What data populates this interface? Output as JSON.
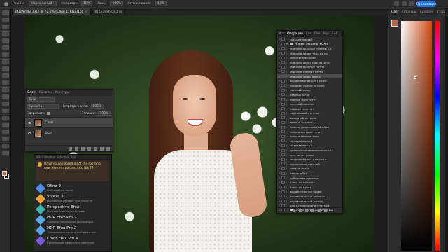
{
  "menubar": {
    "mode_label": "Режим:",
    "mode_value": "Нормальный",
    "opacity_label": "Непрозр.:",
    "opacity_value": "10%",
    "flow_label": "Наж.:",
    "flow_value": "100%",
    "smoothing_label": "Сглаживание:",
    "smoothing_value": "10%",
    "share_label": "Публикация"
  },
  "doc_tabs": [
    {
      "label": "0U2A7864.CR2 @ 72,6% (Слой 1, RGB/16)",
      "close": "×"
    },
    {
      "label": "0U2A7886.CR2 @",
      "close": ""
    }
  ],
  "layers_panel": {
    "tabs": [
      "Слои",
      "Каналы",
      "Контуры"
    ],
    "kind_value": "Вид",
    "blend_value": "Яркость",
    "opacity_label": "Непрозрачность:",
    "opacity_value": "100%",
    "lock_label": "Закрепить:",
    "fill_label": "Заливка:",
    "fill_value": "100%",
    "layers": [
      {
        "name": "Слой 1",
        "selected": true
      },
      {
        "name": "Фон",
        "selected": false
      }
    ]
  },
  "plugins_panel": {
    "header": "Nik Collection Selective Tool",
    "promo_text": "Have you explored all of the exciting new features packed into Nik 7?",
    "items": [
      {
        "name": "Dfine 2",
        "desc": "Уменьшение шума",
        "color": "#4a90e2"
      },
      {
        "name": "Viveza 3",
        "desc": "Настройка цвета и тональности",
        "color": "#e6a23c"
      },
      {
        "name": "Perspective Efex",
        "desc": "Исправление перспективы",
        "color": "#3fb8af"
      },
      {
        "name": "HDR Efex Pro 2",
        "desc": "Слияние нескольких экспозиций",
        "color": "#5aa9e6"
      },
      {
        "name": "HDR Efex Pro 2",
        "desc": "Тонирование одного изображения",
        "color": "#5aa9e6"
      },
      {
        "name": "Color Efex Pro 4",
        "desc": "Креативные эффекты и цветокор",
        "color": "#7a5bd6"
      }
    ]
  },
  "actions_panel": {
    "tabs": [
      "Ист",
      "Операции",
      "Кол",
      "Сво",
      "Кор",
      "Биб"
    ],
    "active_tab": "Операции",
    "rows": [
      {
        "label": "сохранение веб",
        "caret": "",
        "kind": "item"
      },
      {
        "label": "НОВЫЕ ЭКШЕНЫ КОЖА",
        "caret": "▾",
        "kind": "set"
      },
      {
        "label": "убираем красные тона на ко",
        "caret": "›",
        "kind": "item"
      },
      {
        "label": "убираем синие тона на ко",
        "caret": "›",
        "kind": "item"
      },
      {
        "label": "увеличение шума",
        "caret": "›",
        "kind": "item"
      },
      {
        "label": "убираем синие подглазины",
        "caret": "›",
        "kind": "item"
      },
      {
        "label": "убираем красные пятна",
        "caret": "›",
        "kind": "item"
      },
      {
        "label": "убираем желтые пятна",
        "caret": "›",
        "kind": "item"
      },
      {
        "label": "убираем жир и блеск",
        "caret": "›",
        "kind": "item",
        "selected": true
      },
      {
        "label": "выравнивание цвет кожи",
        "caret": "›",
        "kind": "item"
      },
      {
        "label": "придаём сочность коже",
        "caret": "›",
        "kind": "item"
      },
      {
        "label": "светлый загар",
        "caret": "›",
        "kind": "item"
      },
      {
        "label": "темный загар",
        "caret": "›",
        "kind": "item"
      },
      {
        "label": "теплый фрагмент",
        "caret": "›",
        "kind": "item"
      },
      {
        "label": "светлый сонотон",
        "caret": "›",
        "kind": "item"
      },
      {
        "label": "темный сонотон",
        "caret": "›",
        "kind": "item"
      },
      {
        "label": "персиковый оттенок",
        "caret": "›",
        "kind": "item"
      },
      {
        "label": "холодный оттенок",
        "caret": "›",
        "kind": "item"
      },
      {
        "label": "теплый оттенок",
        "caret": "›",
        "kind": "item"
      },
      {
        "label": "тонкая прорисовка объёма",
        "caret": "›",
        "kind": "item"
      },
      {
        "label": "только светлые тона",
        "caret": "›",
        "kind": "item"
      },
      {
        "label": "только тёмные тона",
        "caret": "›",
        "kind": "item"
      },
      {
        "label": "матовая кожа 1",
        "caret": "›",
        "kind": "item"
      },
      {
        "label": "матовая кожа 2",
        "caret": "›",
        "kind": "item"
      },
      {
        "label": "деликатное смягчение кожи",
        "caret": "›",
        "kind": "item"
      },
      {
        "label": "смягчение кожи",
        "caret": "›",
        "kind": "item"
      },
      {
        "label": "микроконтраст для кожи",
        "caret": "›",
        "kind": "item"
      },
      {
        "label": "проявление деталей",
        "caret": "›",
        "kind": "item"
      },
      {
        "label": "прозрачность",
        "caret": "›",
        "kind": "item"
      },
      {
        "label": "белые зубы",
        "caret": "›",
        "kind": "item"
      },
      {
        "label": "добавляем румянца",
        "caret": "›",
        "kind": "item"
      },
      {
        "label": "блеск на волосах",
        "caret": "›",
        "kind": "item"
      },
      {
        "label": "блеск на губах",
        "caret": "›",
        "kind": "item"
      },
      {
        "label": "выразительные брови",
        "caret": "›",
        "kind": "item"
      },
      {
        "label": "выразительные ресницы",
        "caret": "›",
        "kind": "item"
      },
      {
        "label": "выразительный взгляд",
        "caret": "›",
        "kind": "item"
      },
      {
        "label": "для публикации инстаграм",
        "caret": "›",
        "kind": "item"
      },
      {
        "label": "НОВЫЕ ОСЕННИЕ ЭКШЕНЫ",
        "caret": "›",
        "kind": "set"
      }
    ]
  },
  "right_panel": {
    "tabs": [
      "Цвет",
      "Образцы",
      "Градиен",
      "Узоры"
    ],
    "foreground_color": "#b8684a"
  },
  "toolbar": {
    "foreground_color": "#b8684a",
    "background_color": "#111111"
  }
}
